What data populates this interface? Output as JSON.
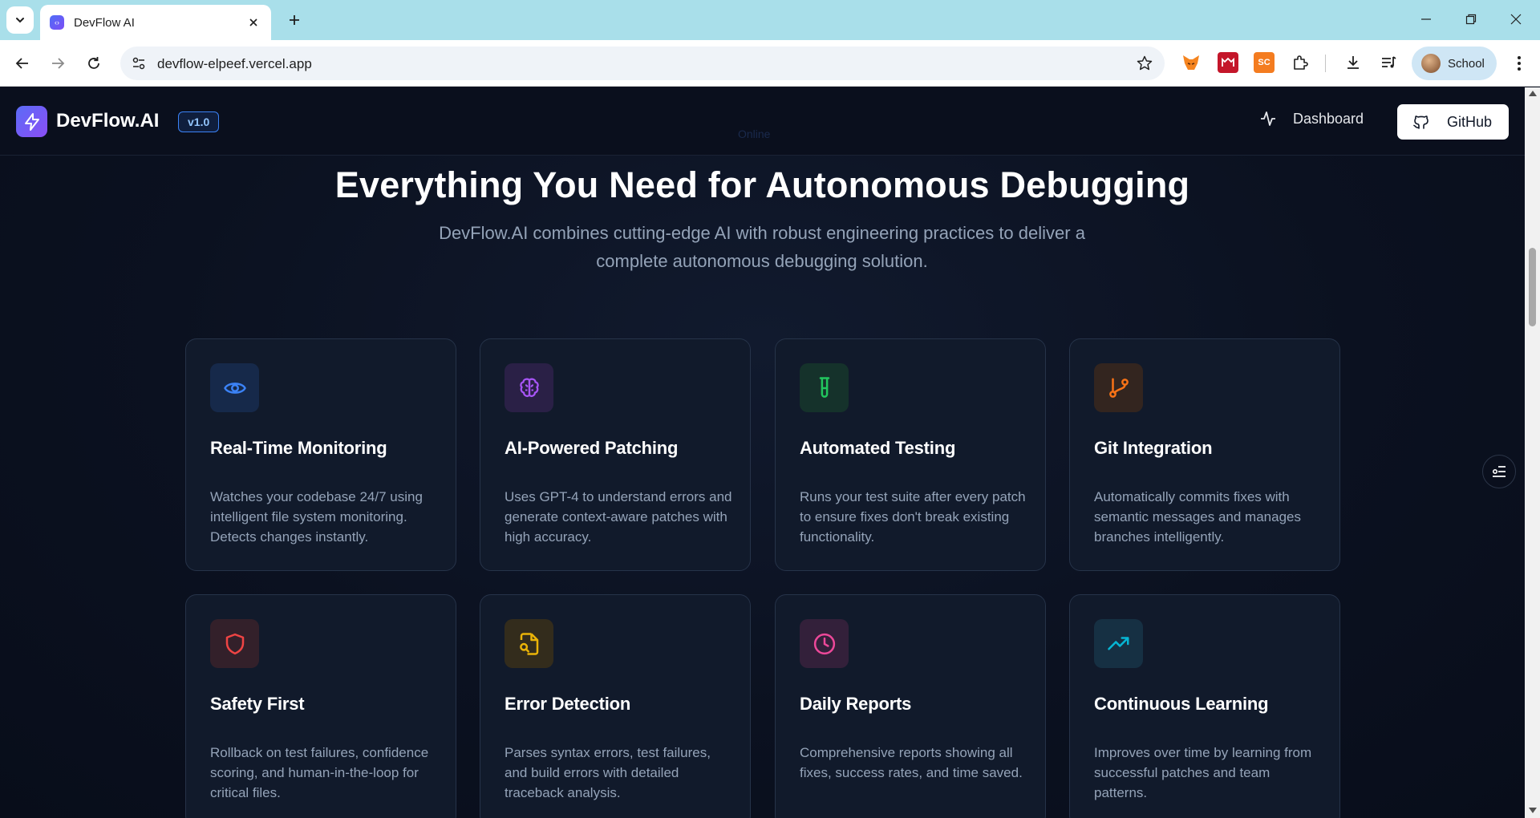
{
  "browser": {
    "tab_title": "DevFlow AI",
    "url": "devflow-elpeef.vercel.app",
    "profile_name": "School",
    "extensions": [
      {
        "name": "fox-extension-icon",
        "label": "",
        "color": "#f5841f"
      },
      {
        "name": "grid-extension-icon",
        "label": "",
        "color": "#c4162a"
      },
      {
        "name": "sc-extension-icon",
        "label": "SC",
        "color": "#f47c20"
      }
    ]
  },
  "site": {
    "logo_text": "DevFlow.AI",
    "version": "v1.0",
    "nav_ghost": "Online",
    "nav_dashboard": "Dashboard",
    "nav_github": "GitHub"
  },
  "hero": {
    "title": "Everything You Need for Autonomous Debugging",
    "subtitle": "DevFlow.AI combines cutting-edge AI with robust engineering practices to deliver a complete autonomous debugging solution."
  },
  "features": [
    {
      "title": "Real-Time Monitoring",
      "description": "Watches your codebase 24/7 using intelligent file system monitoring. Detects changes instantly.",
      "icon": "eye-icon",
      "color": "#3b82f6",
      "bg": "#16294a"
    },
    {
      "title": "AI-Powered Patching",
      "description": "Uses GPT-4 to understand errors and generate context-aware patches with high accuracy.",
      "icon": "brain-icon",
      "color": "#a855f7",
      "bg": "#2a2046"
    },
    {
      "title": "Automated Testing",
      "description": "Runs your test suite after every patch to ensure fixes don't break existing functionality.",
      "icon": "test-tube-icon",
      "color": "#22c55e",
      "bg": "#15322b"
    },
    {
      "title": "Git Integration",
      "description": "Automatically commits fixes with semantic messages and manages branches intelligently.",
      "icon": "git-branch-icon",
      "color": "#f97316",
      "bg": "#33251f"
    },
    {
      "title": "Safety First",
      "description": "Rollback on test failures, confidence scoring, and human-in-the-loop for critical files.",
      "icon": "shield-icon",
      "color": "#ef4444",
      "bg": "#33202a"
    },
    {
      "title": "Error Detection",
      "description": "Parses syntax errors, test failures, and build errors with detailed traceback analysis.",
      "icon": "file-search-icon",
      "color": "#eab308",
      "bg": "#332c1c"
    },
    {
      "title": "Daily Reports",
      "description": "Comprehensive reports showing all fixes, success rates, and time saved.",
      "icon": "clock-icon",
      "color": "#ec4899",
      "bg": "#33203a"
    },
    {
      "title": "Continuous Learning",
      "description": "Improves over time by learning from successful patches and team patterns.",
      "icon": "trending-up-icon",
      "color": "#06b6d4",
      "bg": "#163043"
    }
  ]
}
